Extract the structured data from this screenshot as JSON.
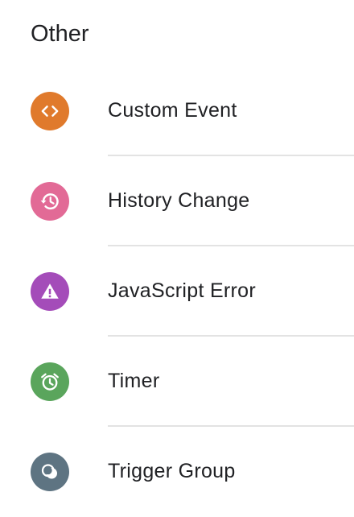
{
  "section": {
    "title": "Other"
  },
  "items": [
    {
      "label": "Custom Event",
      "icon": "code-brackets-icon",
      "color": "#e07a2c"
    },
    {
      "label": "History Change",
      "icon": "history-icon",
      "color": "#e26a96"
    },
    {
      "label": "JavaScript Error",
      "icon": "warning-icon",
      "color": "#a44cb9"
    },
    {
      "label": "Timer",
      "icon": "alarm-clock-icon",
      "color": "#5aa55c"
    },
    {
      "label": "Trigger Group",
      "icon": "trigger-group-icon",
      "color": "#5e7482"
    }
  ]
}
